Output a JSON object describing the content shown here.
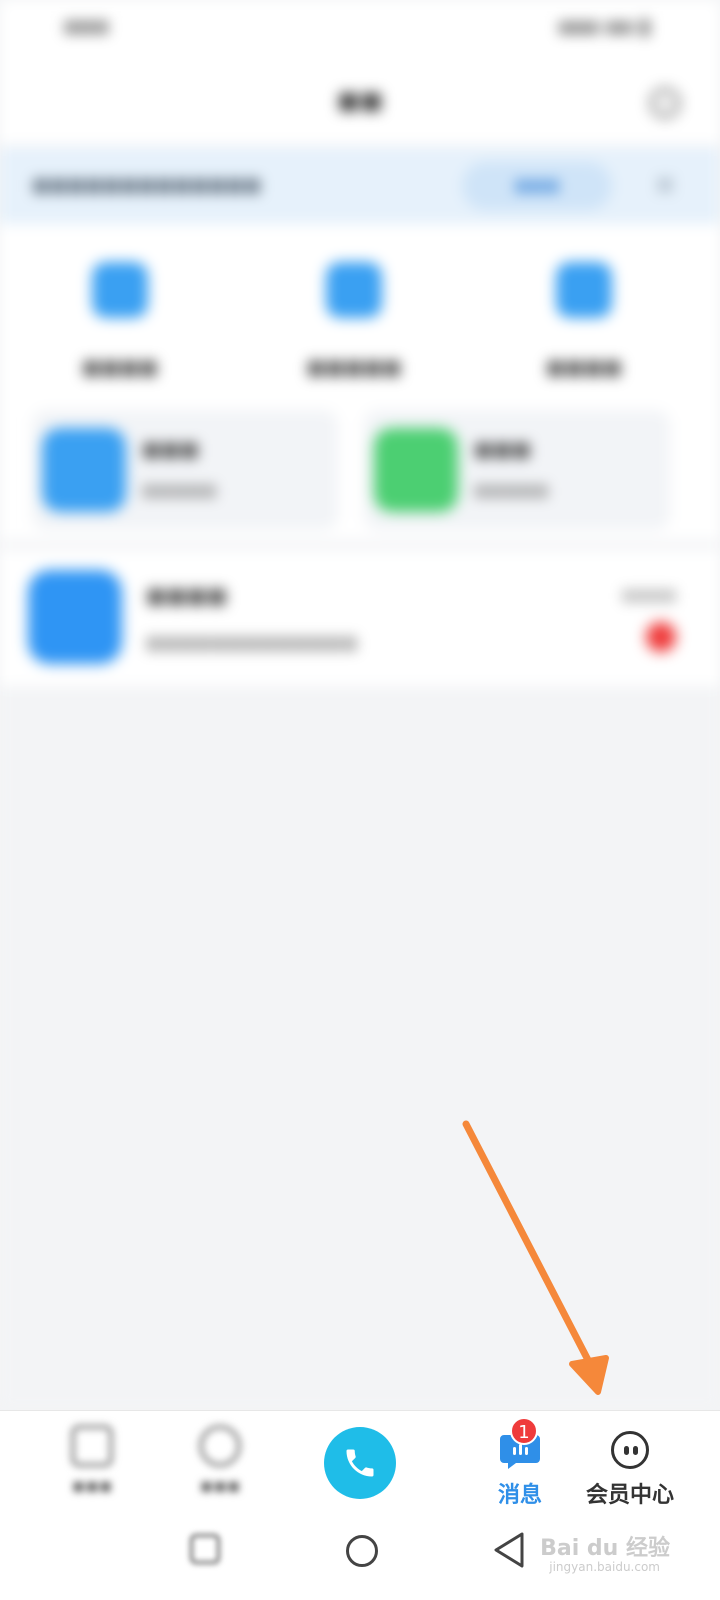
{
  "bottom_nav": {
    "messages": {
      "label": "消息",
      "badge": "1"
    },
    "member_center": {
      "label": "会员中心"
    }
  },
  "watermark": {
    "brand": "Bai du 经验",
    "url": "jingyan.baidu.com"
  },
  "colors": {
    "accent_blue": "#2f8fe8",
    "badge_red": "#ef3b3b",
    "call_cyan": "#1fbde8",
    "arrow_orange": "#f5883a"
  },
  "icons": [
    "search-icon",
    "phone-icon",
    "chat-bubble-icon",
    "smiley-face-icon",
    "home-circle-icon",
    "back-triangle-icon"
  ]
}
